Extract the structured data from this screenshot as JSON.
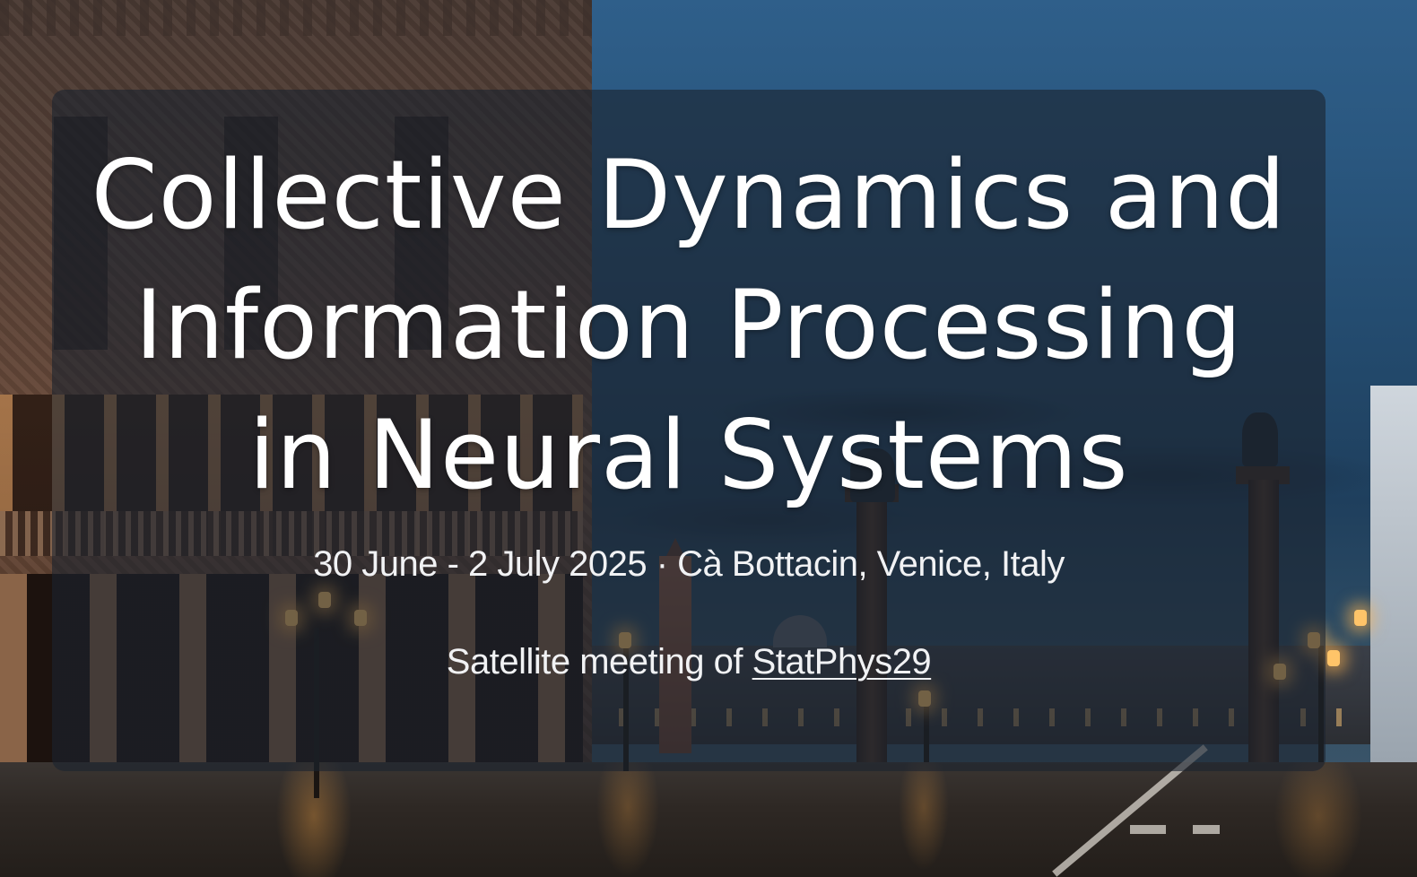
{
  "hero": {
    "title_lines": [
      "Collective Dynamics and",
      "Information Processing",
      "in Neural Systems"
    ],
    "dates": "30 June - 2 July 2025",
    "separator": " · ",
    "location": "Cà Bottacin, Venice, Italy",
    "satellite_prefix": "Satellite meeting of ",
    "satellite_link_text": "StatPhys29"
  }
}
